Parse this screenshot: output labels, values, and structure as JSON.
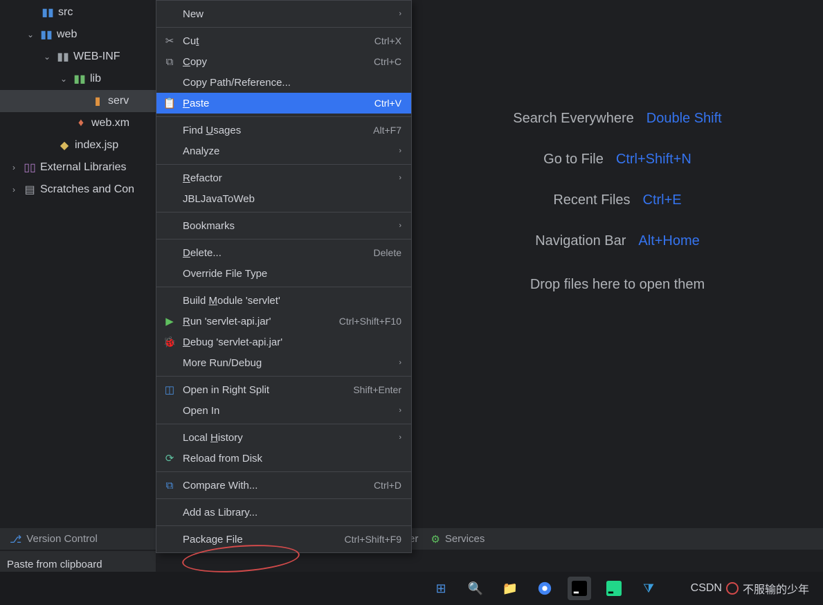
{
  "tree": {
    "src": "src",
    "web": "web",
    "webinf": "WEB-INF",
    "lib": "lib",
    "servlet_jar": "serv",
    "webxml": "web.xm",
    "indexjsp": "index.jsp",
    "external": "External Libraries",
    "scratches": "Scratches and Con"
  },
  "menu": {
    "new": "New",
    "cut": {
      "label": "Cut",
      "shortcut": "Ctrl+X"
    },
    "copy": {
      "label": "Copy",
      "shortcut": "Ctrl+C"
    },
    "copy_path": "Copy Path/Reference...",
    "paste": {
      "label": "Paste",
      "shortcut": "Ctrl+V"
    },
    "find_usages": {
      "label": "Find Usages",
      "shortcut": "Alt+F7"
    },
    "analyze": "Analyze",
    "refactor": "Refactor",
    "jbljava": "JBLJavaToWeb",
    "bookmarks": "Bookmarks",
    "delete": {
      "label": "Delete...",
      "shortcut": "Delete"
    },
    "override": "Override File Type",
    "build_module": "Build Module 'servlet'",
    "run": {
      "label": "Run 'servlet-api.jar'",
      "shortcut": "Ctrl+Shift+F10"
    },
    "debug": "Debug 'servlet-api.jar'",
    "more_run": "More Run/Debug",
    "open_split": {
      "label": "Open in Right Split",
      "shortcut": "Shift+Enter"
    },
    "open_in": "Open In",
    "local_history": "Local History",
    "reload": "Reload from Disk",
    "compare": {
      "label": "Compare With...",
      "shortcut": "Ctrl+D"
    },
    "add_library": "Add as Library...",
    "package_file": {
      "label": "Package File",
      "shortcut": "Ctrl+Shift+F9"
    }
  },
  "editor": {
    "search_everywhere": {
      "label": "Search Everywhere",
      "key": "Double Shift"
    },
    "go_to_file": {
      "label": "Go to File",
      "key": "Ctrl+Shift+N"
    },
    "recent_files": {
      "label": "Recent Files",
      "key": "Ctrl+E"
    },
    "nav_bar": {
      "label": "Navigation Bar",
      "key": "Alt+Home"
    },
    "drop_hint": "Drop files here to open them"
  },
  "status": {
    "version_control": "Version Control",
    "profiler": "Profiler",
    "services": "Services",
    "paste_clipboard": "Paste from clipboard"
  },
  "watermark": "CSDN   不服输的少年"
}
